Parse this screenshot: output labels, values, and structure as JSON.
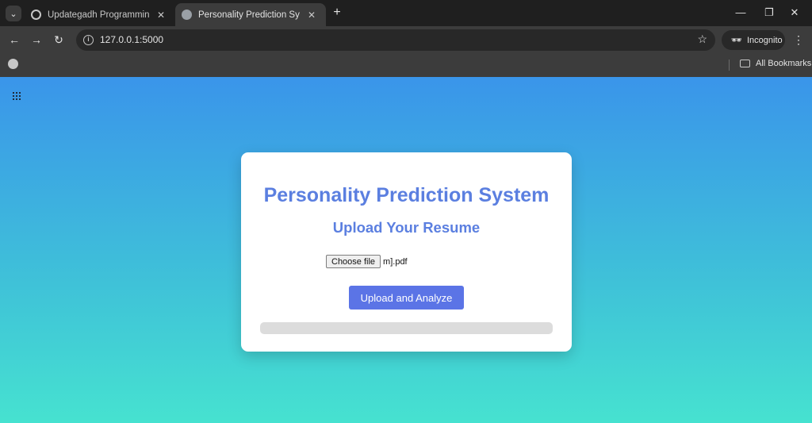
{
  "browser": {
    "tabs": [
      {
        "title": "Updategadh Programming - Up",
        "active": false
      },
      {
        "title": "Personality Prediction System",
        "active": true
      }
    ],
    "url": "127.0.0.1:5000",
    "profile_label": "Incognito",
    "bookmarks_label": "All Bookmarks",
    "icons": {
      "tab_search": "chevron-down-icon",
      "new_tab": "plus-icon",
      "back": "arrow-left-icon",
      "forward": "arrow-right-icon",
      "reload": "reload-icon",
      "site_info": "info-icon",
      "bookmark": "star-icon",
      "menu": "kebab-menu-icon"
    }
  },
  "page": {
    "title": "Personality Prediction System",
    "subtitle": "Upload Your Resume",
    "file_button_label": "Choose file",
    "file_name": "m].pdf",
    "submit_label": "Upload and Analyze",
    "progress_percent": 0
  },
  "colors": {
    "accent": "#5b74e6",
    "heading": "#5b7fe0",
    "gradient_top": "#3a95ea",
    "gradient_bottom": "#46e2d0"
  }
}
